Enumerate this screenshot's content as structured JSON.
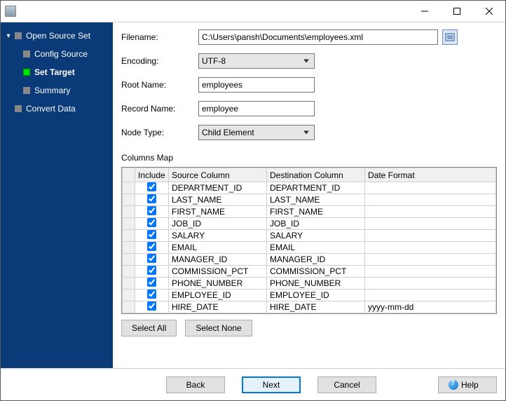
{
  "titlebar": {
    "title": ""
  },
  "sidebar": {
    "items": [
      {
        "label": "Open Source Set",
        "expanded": true,
        "current": false,
        "children": [
          {
            "label": "Config Source",
            "current": false
          },
          {
            "label": "Set Target",
            "current": true
          },
          {
            "label": "Summary",
            "current": false
          }
        ]
      },
      {
        "label": "Convert Data",
        "expanded": false,
        "current": false
      }
    ]
  },
  "form": {
    "filename_label": "Filename:",
    "filename_value": "C:\\Users\\pansh\\Documents\\employees.xml",
    "encoding_label": "Encoding:",
    "encoding_value": "UTF-8",
    "root_label": "Root Name:",
    "root_value": "employees",
    "record_label": "Record Name:",
    "record_value": "employee",
    "nodetype_label": "Node Type:",
    "nodetype_value": "Child Element"
  },
  "columns_map": {
    "title": "Columns Map",
    "headers": {
      "include": "Include",
      "source": "Source Column",
      "destination": "Destination Column",
      "dateformat": "Date Format"
    },
    "rows": [
      {
        "include": true,
        "source": "DEPARTMENT_ID",
        "destination": "DEPARTMENT_ID",
        "dateformat": ""
      },
      {
        "include": true,
        "source": "LAST_NAME",
        "destination": "LAST_NAME",
        "dateformat": ""
      },
      {
        "include": true,
        "source": "FIRST_NAME",
        "destination": "FIRST_NAME",
        "dateformat": ""
      },
      {
        "include": true,
        "source": "JOB_ID",
        "destination": "JOB_ID",
        "dateformat": ""
      },
      {
        "include": true,
        "source": "SALARY",
        "destination": "SALARY",
        "dateformat": ""
      },
      {
        "include": true,
        "source": "EMAIL",
        "destination": "EMAIL",
        "dateformat": ""
      },
      {
        "include": true,
        "source": "MANAGER_ID",
        "destination": "MANAGER_ID",
        "dateformat": ""
      },
      {
        "include": true,
        "source": "COMMISSION_PCT",
        "destination": "COMMISSION_PCT",
        "dateformat": ""
      },
      {
        "include": true,
        "source": "PHONE_NUMBER",
        "destination": "PHONE_NUMBER",
        "dateformat": ""
      },
      {
        "include": true,
        "source": "EMPLOYEE_ID",
        "destination": "EMPLOYEE_ID",
        "dateformat": ""
      },
      {
        "include": true,
        "source": "HIRE_DATE",
        "destination": "HIRE_DATE",
        "dateformat": "yyyy-mm-dd"
      }
    ]
  },
  "buttons": {
    "select_all": "Select All",
    "select_none": "Select None",
    "back": "Back",
    "next": "Next",
    "cancel": "Cancel",
    "help": "Help"
  }
}
